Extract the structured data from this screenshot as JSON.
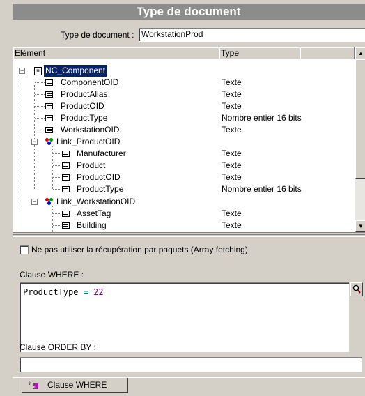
{
  "title": "Type de document",
  "doc_type": {
    "label": "Type de document :",
    "value": "WorkstationProd"
  },
  "grid": {
    "col_element": "Elément",
    "col_type": "Type",
    "rows": [
      {
        "name": "NC_Component",
        "type": ""
      },
      {
        "name": "ComponentOID",
        "type": "Texte"
      },
      {
        "name": "ProductAlias",
        "type": "Texte"
      },
      {
        "name": "ProductOID",
        "type": "Texte"
      },
      {
        "name": "ProductType",
        "type": "Nombre entier 16 bits"
      },
      {
        "name": "WorkstationOID",
        "type": "Texte"
      },
      {
        "name": "Link_ProductOID",
        "type": ""
      },
      {
        "name": "Manufacturer",
        "type": "Texte"
      },
      {
        "name": "Product",
        "type": "Texte"
      },
      {
        "name": "ProductOID",
        "type": "Texte"
      },
      {
        "name": "ProductType",
        "type": "Nombre entier 16 bits"
      },
      {
        "name": "Link_WorkstationOID",
        "type": ""
      },
      {
        "name": "AssetTag",
        "type": "Texte"
      },
      {
        "name": "Building",
        "type": "Texte"
      }
    ]
  },
  "array_fetching": {
    "label": "Ne pas utiliser la récupération par paquets (Array fetching)",
    "checked": false
  },
  "where": {
    "label": "Clause WHERE :",
    "code_field": "ProductType",
    "code_op": "=",
    "code_value": "22"
  },
  "order_by": {
    "label": "Clause ORDER BY :",
    "value": ""
  },
  "tab": {
    "label": "Clause WHERE"
  },
  "colors": {
    "selection": "#0a246a",
    "operator": "#008080",
    "number": "#800080"
  }
}
